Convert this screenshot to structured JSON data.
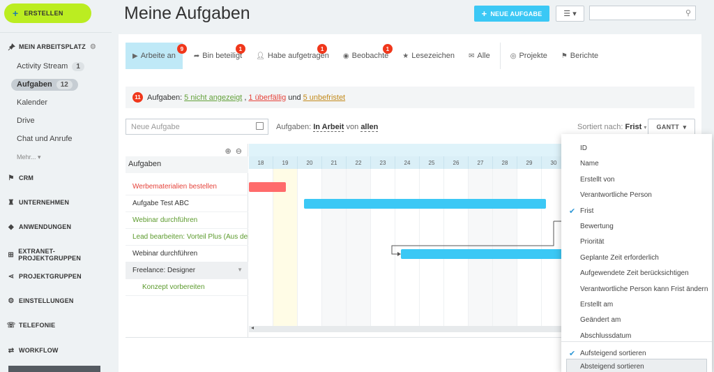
{
  "sidebar": {
    "create_label": "ERSTELLEN",
    "workspace_label": "MEIN ARBEITSPLATZ",
    "items": [
      {
        "label": "Activity Stream",
        "count": "1"
      },
      {
        "label": "Aufgaben",
        "count": "12"
      },
      {
        "label": "Kalender"
      },
      {
        "label": "Drive"
      },
      {
        "label": "Chat und Anrufe"
      }
    ],
    "more_label": "Mehr...",
    "sections": [
      {
        "label": "CRM",
        "icon": "flag-icon"
      },
      {
        "label": "UNTERNEHMEN",
        "icon": "tower-icon"
      },
      {
        "label": "ANWENDUNGEN",
        "icon": "cubes-icon"
      },
      {
        "label": "EXTRANET-PROJEKTGRUPPEN",
        "icon": "sitemap-icon"
      },
      {
        "label": "PROJEKTGRUPPEN",
        "icon": "share-icon"
      },
      {
        "label": "EINSTELLUNGEN",
        "icon": "gear-icon"
      },
      {
        "label": "TELEFONIE",
        "icon": "phone-icon"
      },
      {
        "label": "WORKFLOW",
        "icon": "workflow-icon"
      }
    ]
  },
  "header": {
    "title": "Meine Aufgaben",
    "new_task_label": "NEUE AUFGABE",
    "search_placeholder": ""
  },
  "tabs": [
    {
      "label": "Arbeite an",
      "badge": "9",
      "icon": "play-icon",
      "active": true
    },
    {
      "label": "Bin beteiligt",
      "badge": "1",
      "icon": "arrow-right-icon"
    },
    {
      "label": "Habe aufgetragen",
      "badge": "1",
      "icon": "user-icon"
    },
    {
      "label": "Beobachte",
      "badge": "1",
      "icon": "eye-icon"
    },
    {
      "label": "Lesezeichen",
      "icon": "star-icon"
    },
    {
      "label": "Alle",
      "icon": "inbox-icon"
    },
    {
      "label": "Projekte",
      "icon": "compass-icon"
    },
    {
      "label": "Berichte",
      "icon": "flag-icon"
    }
  ],
  "info": {
    "count": "11",
    "prefix": "Aufgaben:",
    "not_shown": "5 nicht angezeigt",
    "sep": ",",
    "overdue": "1 überfällig",
    "and": "und",
    "no_deadline": "5 unbefristet"
  },
  "filter": {
    "new_task_placeholder": "Neue Aufgabe",
    "tasks_label": "Aufgaben:",
    "status": "In Arbeit",
    "von": "von",
    "who": "allen",
    "sort_label": "Sortiert nach:",
    "sort_value": "Frist",
    "view_label": "GANTT"
  },
  "gantt": {
    "tree_header": "Aufgaben",
    "tasks": [
      {
        "name": "Werbematerialien bestellen",
        "color": "#e5423a"
      },
      {
        "name": "Aufgabe Test ABC",
        "color": "#333333"
      },
      {
        "name": "Webinar durchführen",
        "color": "#5b9a2c"
      },
      {
        "name": "Lead bearbeiten: Vorteil Plus (Aus dem",
        "color": "#5b9a2c"
      },
      {
        "name": "Webinar durchführen",
        "color": "#333333"
      },
      {
        "name": "Freelance: Designer",
        "color": "#333333"
      },
      {
        "name": "Konzept vorbereiten",
        "color": "#5b9a2c"
      }
    ],
    "days": [
      "18",
      "19",
      "20",
      "21",
      "22",
      "23",
      "24",
      "25",
      "26",
      "27",
      "28",
      "29",
      "30"
    ]
  },
  "sort_menu": {
    "items": [
      "ID",
      "Name",
      "Erstellt von",
      "Verantwortliche Person",
      "Frist",
      "Bewertung",
      "Priorität",
      "Geplante Zeit erforderlich",
      "Aufgewendete Zeit berücksichtigen",
      "Verantwortliche Person kann Frist ändern",
      "Erstellt am",
      "Geändert am",
      "Abschlussdatum"
    ],
    "checked_index": 4,
    "asc_label": "Aufsteigend sortieren",
    "desc_label": "Absteigend sortieren"
  }
}
